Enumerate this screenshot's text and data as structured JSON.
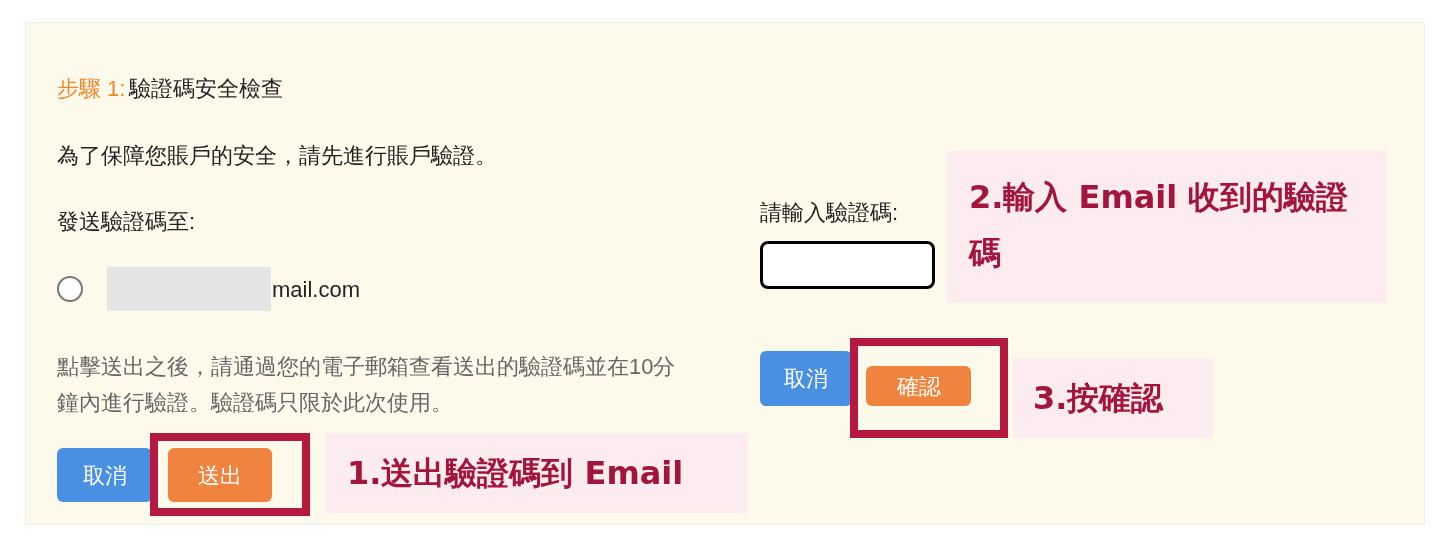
{
  "step": {
    "label": "步驟 1:",
    "title": "驗證碼安全檢查"
  },
  "intro": "為了保障您賬戶的安全，請先進行賬戶驗證。",
  "send_to": {
    "label": "發送驗證碼至:",
    "options": [
      {
        "text": "mail.com",
        "selected": false,
        "redacted": true
      }
    ]
  },
  "note": "點擊送出之後，請通過您的電子郵箱查看送出的驗證碼並在10分鐘內進行驗證。驗證碼只限於此次使用。",
  "left_buttons": [
    {
      "label": "取消",
      "kind": "cancel",
      "highlighted": false
    },
    {
      "label": "送出",
      "kind": "submit",
      "highlighted": true
    }
  ],
  "code_field": {
    "label": "請輸入驗證碼:"
  },
  "right_buttons": [
    {
      "label": "取消",
      "kind": "cancel",
      "highlighted": false
    },
    {
      "label": "確認",
      "kind": "submit",
      "highlighted": true
    }
  ],
  "callouts": [
    {
      "text": "1.送出驗證碼到 Email"
    },
    {
      "text": "2.輸入 Email 收到的驗證碼"
    },
    {
      "text": "3.按確認"
    }
  ]
}
